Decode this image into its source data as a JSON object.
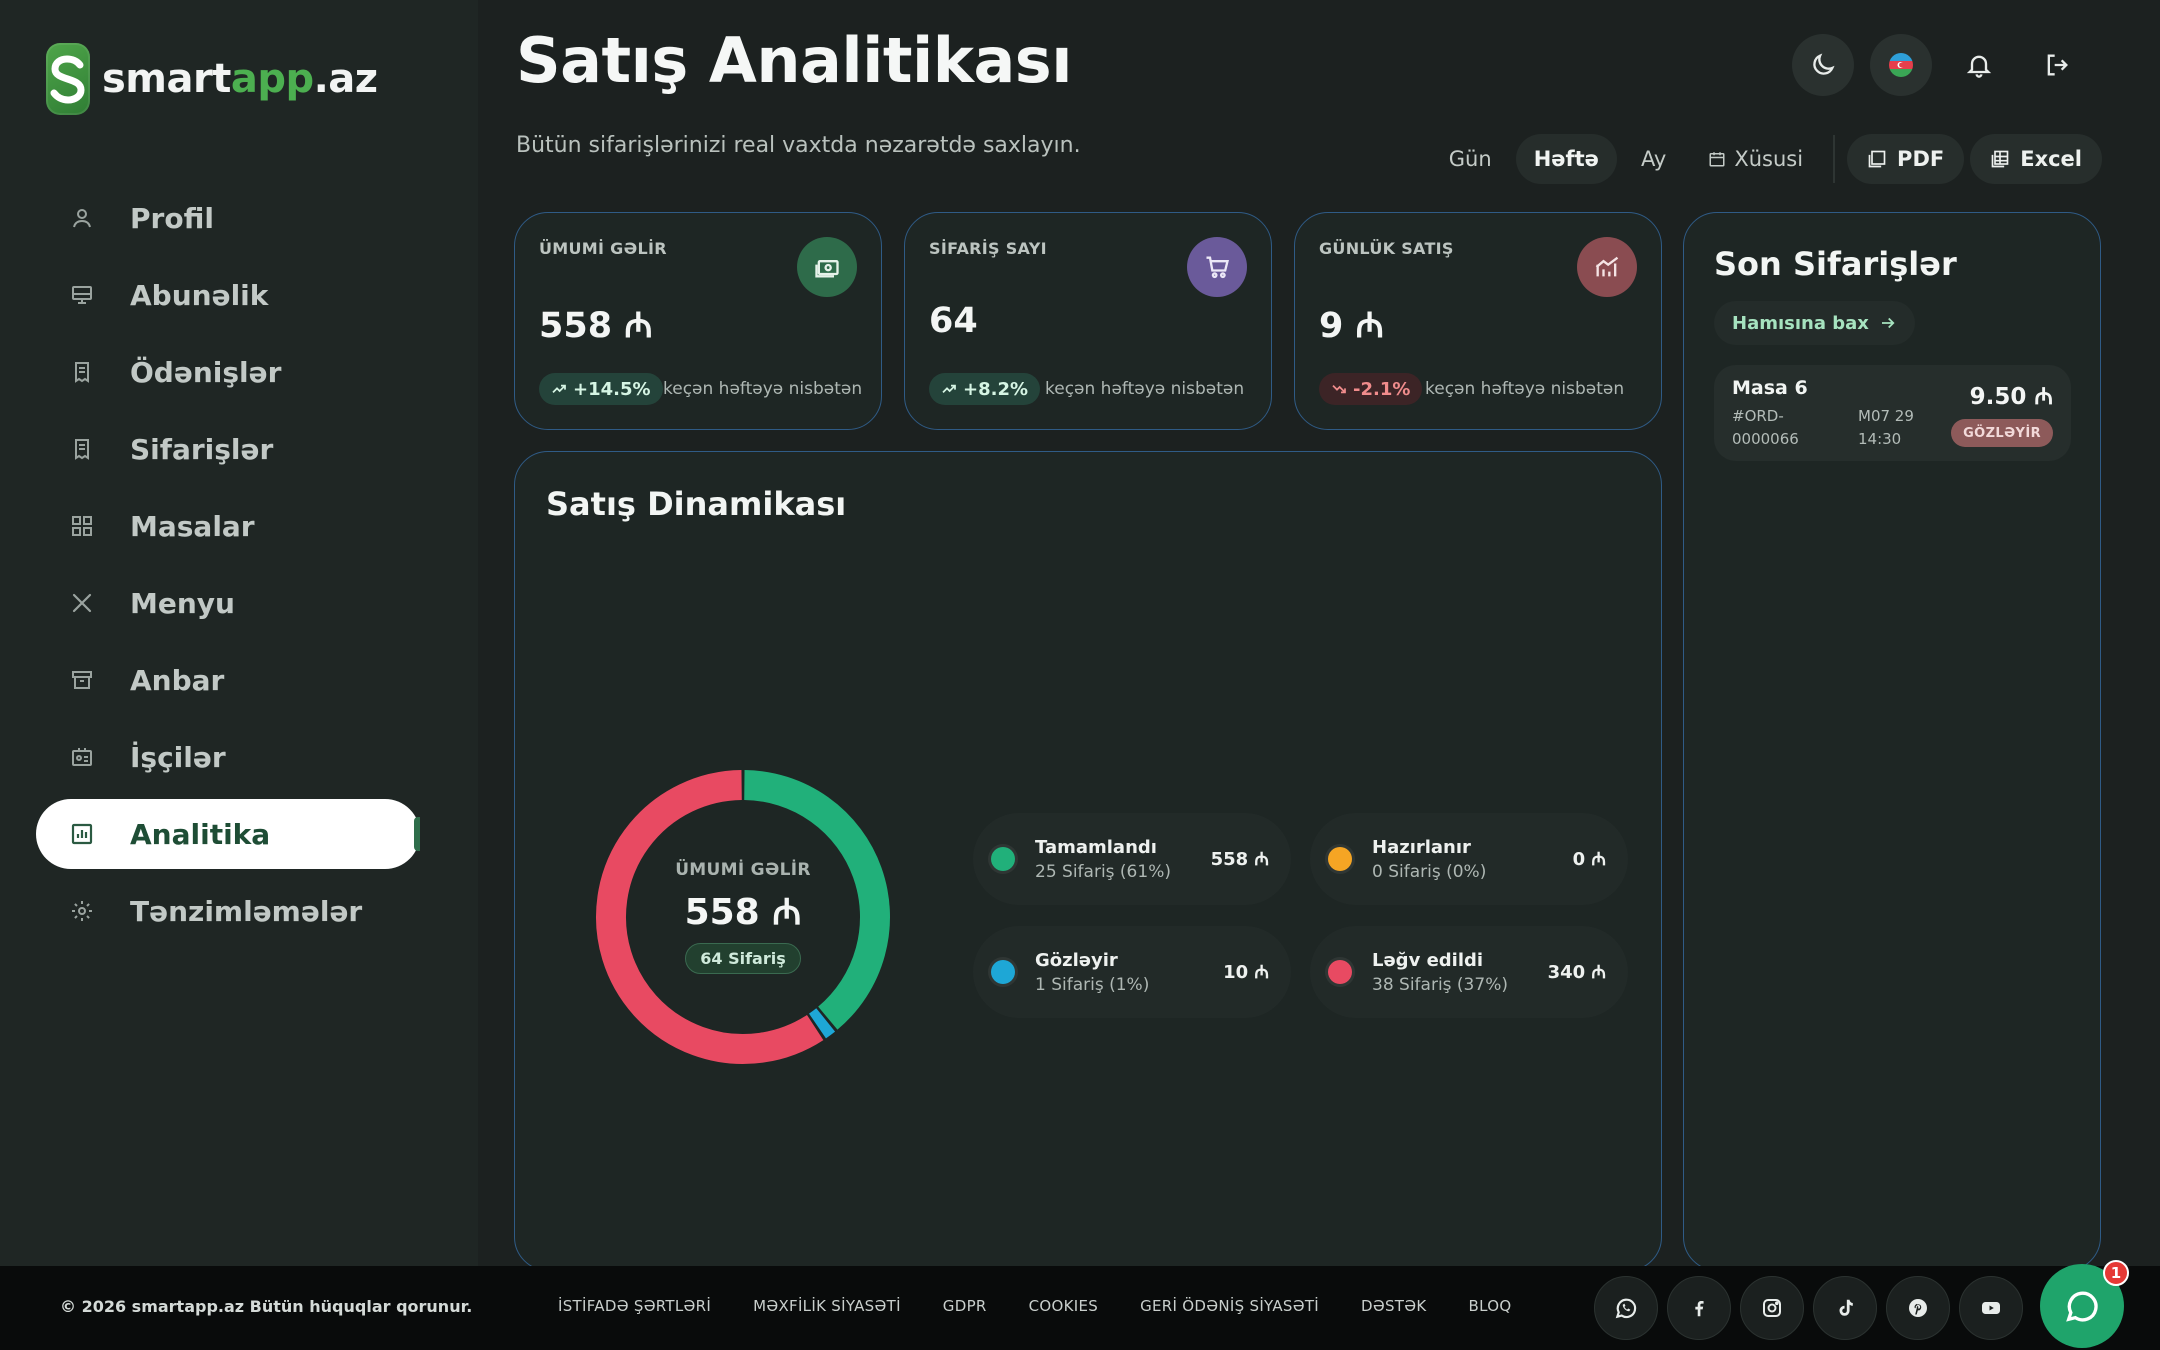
{
  "app": {
    "logo_main": "smart",
    "logo_accent": "app",
    "logo_tld": ".az"
  },
  "sidebar": {
    "items": [
      {
        "label": "Profil",
        "icon": "user-icon"
      },
      {
        "label": "Abunəlik",
        "icon": "monitor-icon"
      },
      {
        "label": "Ödənişlər",
        "icon": "receipt-icon"
      },
      {
        "label": "Sifarişlər",
        "icon": "receipt-icon"
      },
      {
        "label": "Masalar",
        "icon": "grid-icon"
      },
      {
        "label": "Menyu",
        "icon": "utensils-icon"
      },
      {
        "label": "Anbar",
        "icon": "archive-icon"
      },
      {
        "label": "İşçilər",
        "icon": "id-card-icon"
      },
      {
        "label": "Analitika",
        "icon": "chart-icon",
        "active": true
      },
      {
        "label": "Tənzimləmələr",
        "icon": "gear-icon"
      }
    ]
  },
  "header": {
    "title": "Satış Analitikası",
    "subtitle": "Bütün sifarişlərinizi real vaxtda nəzarətdə saxlayın."
  },
  "periods": {
    "day": "Gün",
    "week": "Həftə",
    "month": "Ay",
    "custom": "Xüsusi",
    "selected": "Həftə"
  },
  "exports": {
    "pdf": "PDF",
    "excel": "Excel"
  },
  "stats": [
    {
      "label": "ÜMUMİ GƏLİR",
      "value": "558 ₼",
      "trend": "+14.5%",
      "direction": "up",
      "note": "keçən həftəyə nisbətən",
      "icon": "money-icon",
      "icon_bg": "#2e6b4a"
    },
    {
      "label": "SİFARİŞ SAYI",
      "value": "64",
      "trend": "+8.2%",
      "direction": "up",
      "note": "keçən həftəyə nisbətən",
      "icon": "cart-icon",
      "icon_bg": "#6a5a9a"
    },
    {
      "label": "GÜNLÜK SATIŞ",
      "value": "9 ₼",
      "trend": "-2.1%",
      "direction": "down",
      "note": "keçən həftəyə nisbətən",
      "icon": "chart-line-icon",
      "icon_bg": "#8a4c51"
    }
  ],
  "chart": {
    "title": "Satış Dinamikası",
    "center_label": "ÜMUMİ GƏLİR",
    "center_value": "558 ₼",
    "center_badge": "64 Sifariş"
  },
  "chart_data": {
    "type": "pie",
    "title": "Satış Dinamikası",
    "categories": [
      "Tamamlandı",
      "Hazırlanır",
      "Gözləyir",
      "Ləğv edildi"
    ],
    "values": [
      25,
      0,
      1,
      38
    ],
    "percents": [
      61,
      0,
      1,
      37
    ],
    "amounts": [
      558,
      0,
      10,
      340
    ],
    "colors": [
      "#21b07a",
      "#f5a524",
      "#1ea7d6",
      "#e84a62"
    ],
    "legend": [
      {
        "name": "Tamamlandı",
        "sub": "25 Sifariş (61%)",
        "amount": "558 ₼",
        "color": "#21b07a"
      },
      {
        "name": "Hazırlanır",
        "sub": "0 Sifariş (0%)",
        "amount": "0 ₼",
        "color": "#f5a524"
      },
      {
        "name": "Gözləyir",
        "sub": "1 Sifariş (1%)",
        "amount": "10 ₼",
        "color": "#1ea7d6"
      },
      {
        "name": "Ləğv edildi",
        "sub": "38 Sifariş (37%)",
        "amount": "340 ₼",
        "color": "#e84a62"
      }
    ]
  },
  "orders": {
    "title": "Son Sifarişlər",
    "view_all": "Hamısına bax",
    "items": [
      {
        "table": "Masa 6",
        "id": "#ORD-0000066",
        "time": "M07 29 14:30",
        "amount": "9.50 ₼",
        "status": "GÖZLƏYİR"
      }
    ]
  },
  "footer": {
    "copyright": "© 2026 smartapp.az Bütün hüquqlar qorunur.",
    "links": [
      "İSTİFADƏ ŞƏRTLƏRİ",
      "MƏXFİLİK SİYASƏTİ",
      "GDPR",
      "COOKIES",
      "GERİ ÖDƏNİŞ SİYASƏTİ",
      "DƏSTƏK",
      "BLOQ"
    ],
    "socials": [
      "whatsapp-icon",
      "facebook-icon",
      "instagram-icon",
      "tiktok-icon",
      "pinterest-icon",
      "youtube-icon"
    ],
    "chat_badge": "1"
  }
}
